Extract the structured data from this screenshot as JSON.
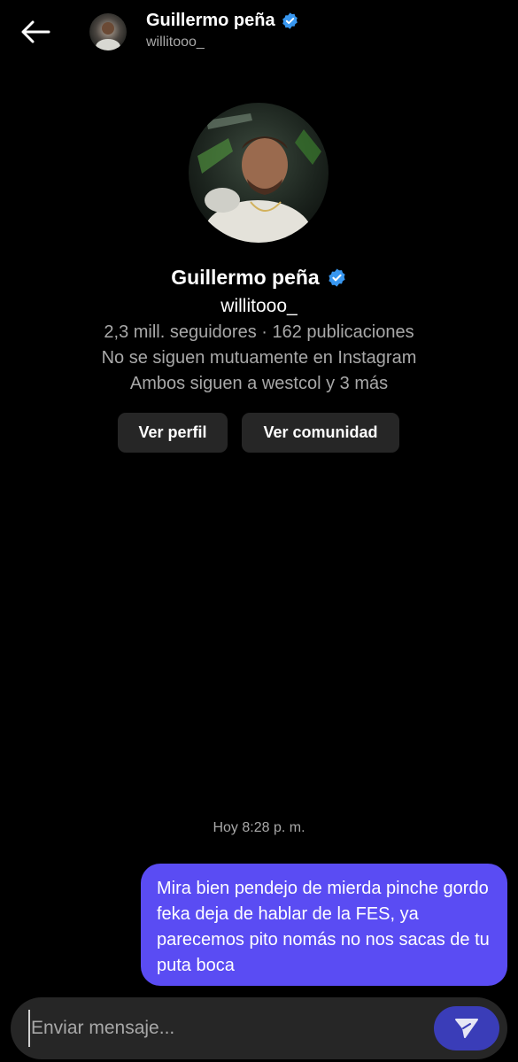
{
  "header": {
    "name": "Guillermo peña",
    "username": "willitooo_"
  },
  "profile": {
    "name": "Guillermo peña",
    "username": "willitooo_",
    "stats": "2,3 mill. seguidores · 162 publicaciones",
    "mutual": "No se siguen mutuamente en Instagram",
    "follows": "Ambos siguen a westcol y 3 más"
  },
  "buttons": {
    "view_profile": "Ver perfil",
    "view_community": "Ver comunidad"
  },
  "chat": {
    "timestamp": "Hoy 8:28 p. m.",
    "message": "Mira bien pendejo de mierda pinche gordo feka deja de hablar de la FES, ya parecemos pito nomás no nos sacas de tu puta boca"
  },
  "composer": {
    "placeholder": "Enviar mensaje..."
  },
  "colors": {
    "background": "#000000",
    "bubble": "#5a4cf3",
    "button": "#262626",
    "verified": "#3897f0",
    "send": "#3a3db8",
    "muted_text": "#a8a8a8"
  },
  "icons": {
    "back": "arrow-left-icon",
    "verified": "verified-badge-icon",
    "send": "send-icon"
  }
}
